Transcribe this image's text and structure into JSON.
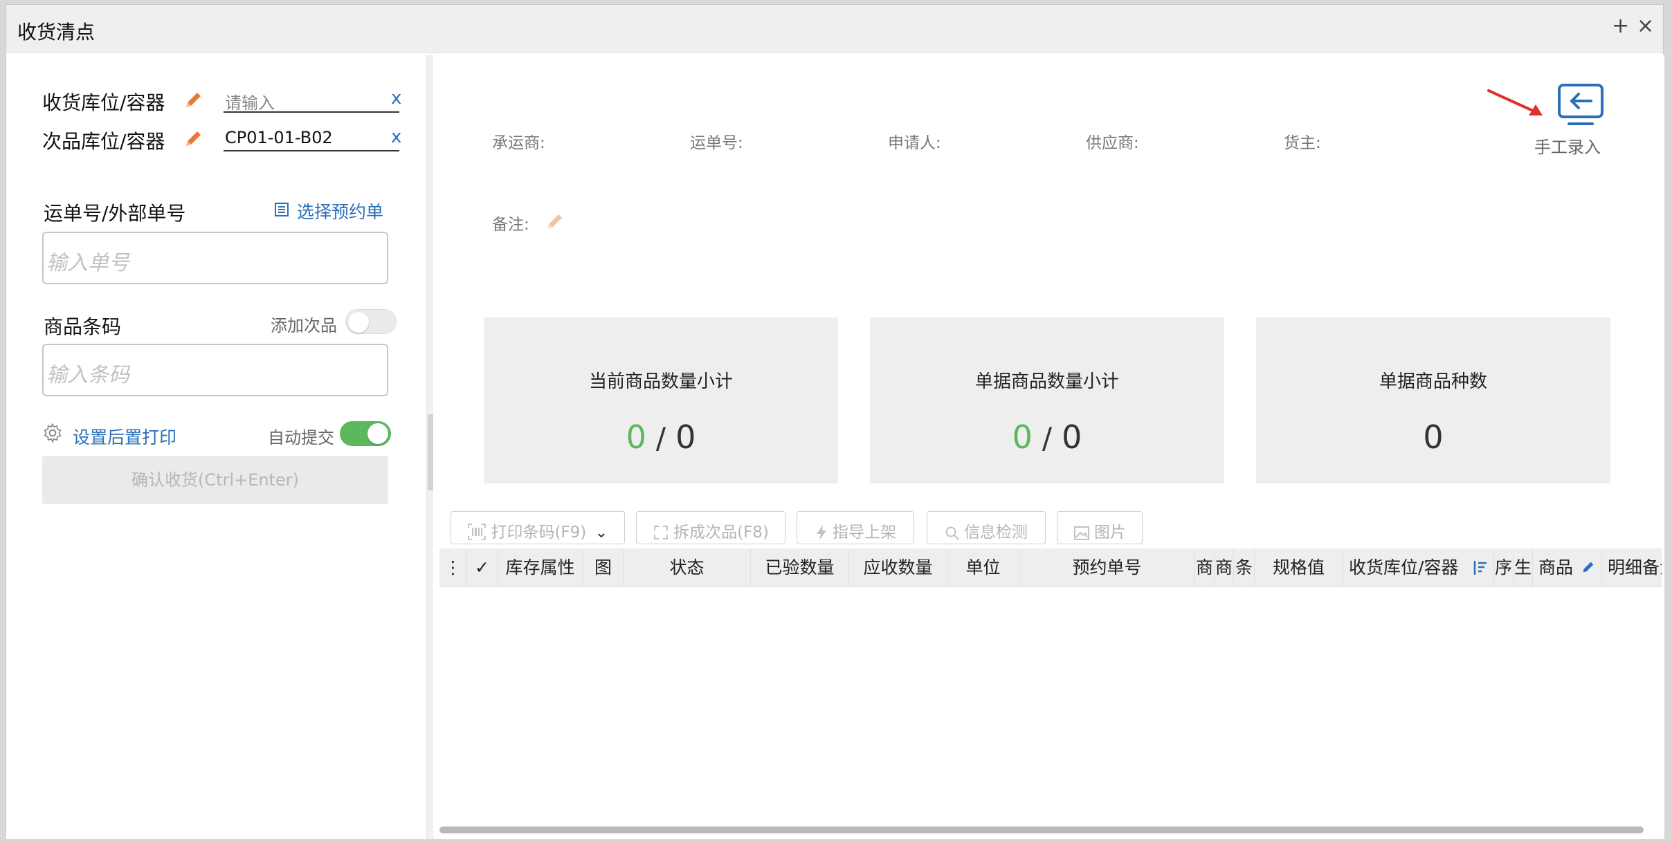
{
  "window": {
    "title": "收货清点",
    "add_icon": "+",
    "close_icon": "×"
  },
  "left": {
    "receive_location": {
      "label": "收货库位/容器",
      "placeholder": "请输入",
      "value": "",
      "clear": "x"
    },
    "defect_location": {
      "label": "次品库位/容器",
      "value": "CP01-01-B02",
      "clear": "x"
    },
    "waybill": {
      "label": "运单号/外部单号",
      "link": "选择预约单",
      "placeholder": "输入单号"
    },
    "barcode": {
      "label": "商品条码",
      "add_defect_label": "添加次品",
      "add_defect_on": false,
      "placeholder": "输入条码"
    },
    "print_settings": {
      "link": "设置后置打印",
      "auto_submit_label": "自动提交",
      "auto_submit_on": true
    },
    "confirm_button": "确认收货(Ctrl+Enter)"
  },
  "right": {
    "info": {
      "carrier": "承运商:",
      "waybill_no": "运单号:",
      "applicant": "申请人:",
      "supplier": "供应商:",
      "owner": "货主:",
      "remark": "备注:"
    },
    "manual_entry": "手工录入",
    "cards": [
      {
        "title": "当前商品数量小计",
        "value_a": "0",
        "sep": "/",
        "value_b": "0"
      },
      {
        "title": "单据商品数量小计",
        "value_a": "0",
        "sep": "/",
        "value_b": "0"
      },
      {
        "title": "单据商品种数",
        "value": "0"
      }
    ],
    "toolbar": {
      "print_barcode": "打印条码(F9)",
      "split_defect": "拆成次品(F8)",
      "guide_shelf": "指导上架",
      "info_check": "信息检测",
      "image": "图片"
    },
    "table_headers": [
      "⋮",
      "✓",
      "库存属性",
      "图",
      "状态",
      "已验数量",
      "应收数量",
      "单位",
      "预约单号",
      "商",
      "商",
      "条",
      "规格值",
      "收货库位/容器",
      "序",
      "生",
      "商品",
      "明细备注"
    ]
  },
  "colors": {
    "accent": "#2a6fb8",
    "green": "#5cb85c",
    "pencil": "#e8793a",
    "arrow": "#e0302a"
  }
}
